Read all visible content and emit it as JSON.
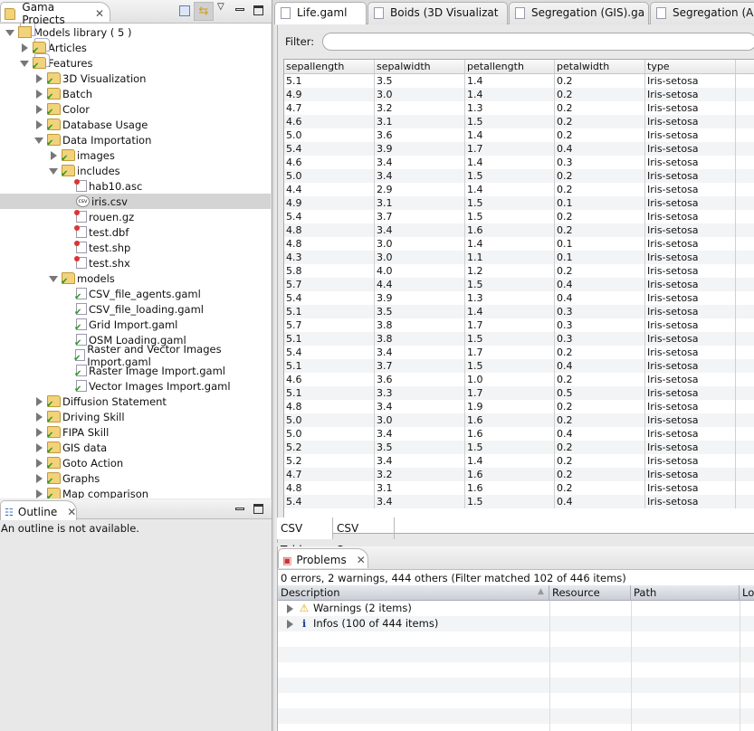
{
  "projects": {
    "title": "Gama Projects",
    "tree": [
      {
        "label": "Models library ( 5 )",
        "level": 0,
        "twisty": "open",
        "icon": "library"
      },
      {
        "label": "Articles",
        "level": 1,
        "twisty": "closed",
        "icon": "library-check"
      },
      {
        "label": "Features",
        "level": 1,
        "twisty": "open",
        "icon": "library-check"
      },
      {
        "label": "3D Visualization",
        "level": 2,
        "twisty": "closed",
        "icon": "folder-check"
      },
      {
        "label": "Batch",
        "level": 2,
        "twisty": "closed",
        "icon": "folder-check"
      },
      {
        "label": "Color",
        "level": 2,
        "twisty": "closed",
        "icon": "folder-check"
      },
      {
        "label": "Database Usage",
        "level": 2,
        "twisty": "closed",
        "icon": "folder-check"
      },
      {
        "label": "Data Importation",
        "level": 2,
        "twisty": "open",
        "icon": "folder-check"
      },
      {
        "label": "images",
        "level": 3,
        "twisty": "closed",
        "icon": "folder-check"
      },
      {
        "label": "includes",
        "level": 3,
        "twisty": "open",
        "icon": "folder-check"
      },
      {
        "label": "hab10.asc",
        "level": 4,
        "twisty": "none",
        "icon": "file"
      },
      {
        "label": "iris.csv",
        "level": 4,
        "twisty": "none",
        "icon": "csv",
        "selected": true
      },
      {
        "label": "rouen.gz",
        "level": 4,
        "twisty": "none",
        "icon": "file"
      },
      {
        "label": "test.dbf",
        "level": 4,
        "twisty": "none",
        "icon": "file"
      },
      {
        "label": "test.shp",
        "level": 4,
        "twisty": "none",
        "icon": "file"
      },
      {
        "label": "test.shx",
        "level": 4,
        "twisty": "none",
        "icon": "file"
      },
      {
        "label": "models",
        "level": 3,
        "twisty": "open",
        "icon": "folder-check"
      },
      {
        "label": "CSV_file_agents.gaml",
        "level": 4,
        "twisty": "none",
        "icon": "gaml"
      },
      {
        "label": "CSV_file_loading.gaml",
        "level": 4,
        "twisty": "none",
        "icon": "gaml"
      },
      {
        "label": "Grid Import.gaml",
        "level": 4,
        "twisty": "none",
        "icon": "gaml"
      },
      {
        "label": "OSM Loading.gaml",
        "level": 4,
        "twisty": "none",
        "icon": "gaml"
      },
      {
        "label": "Raster and Vector Images Import.gaml",
        "level": 4,
        "twisty": "none",
        "icon": "gaml"
      },
      {
        "label": "Raster Image Import.gaml",
        "level": 4,
        "twisty": "none",
        "icon": "gaml"
      },
      {
        "label": "Vector Images Import.gaml",
        "level": 4,
        "twisty": "none",
        "icon": "gaml"
      },
      {
        "label": "Diffusion Statement",
        "level": 2,
        "twisty": "closed",
        "icon": "folder-check"
      },
      {
        "label": "Driving Skill",
        "level": 2,
        "twisty": "closed",
        "icon": "folder-check"
      },
      {
        "label": "FIPA Skill",
        "level": 2,
        "twisty": "closed",
        "icon": "folder-check"
      },
      {
        "label": "GIS data",
        "level": 2,
        "twisty": "closed",
        "icon": "folder-check"
      },
      {
        "label": "Goto Action",
        "level": 2,
        "twisty": "closed",
        "icon": "folder-check"
      },
      {
        "label": "Graphs",
        "level": 2,
        "twisty": "closed",
        "icon": "folder-check"
      },
      {
        "label": "Map comparison",
        "level": 2,
        "twisty": "closed",
        "icon": "folder-check"
      }
    ]
  },
  "outline": {
    "title": "Outline",
    "message": "An outline is not available."
  },
  "editor_tabs": [
    "Life.gaml",
    "Boids (3D Visualizat",
    "Segregation (GIS).ga",
    "Segregation (Age"
  ],
  "csv": {
    "filter_label": "Filter:",
    "filter_value": "",
    "columns": [
      "sepallength",
      "sepalwidth",
      "petallength",
      "petalwidth",
      "type"
    ],
    "rows": [
      [
        "5.1",
        "3.5",
        "1.4",
        "0.2",
        "Iris-setosa"
      ],
      [
        "4.9",
        "3.0",
        "1.4",
        "0.2",
        "Iris-setosa"
      ],
      [
        "4.7",
        "3.2",
        "1.3",
        "0.2",
        "Iris-setosa"
      ],
      [
        "4.6",
        "3.1",
        "1.5",
        "0.2",
        "Iris-setosa"
      ],
      [
        "5.0",
        "3.6",
        "1.4",
        "0.2",
        "Iris-setosa"
      ],
      [
        "5.4",
        "3.9",
        "1.7",
        "0.4",
        "Iris-setosa"
      ],
      [
        "4.6",
        "3.4",
        "1.4",
        "0.3",
        "Iris-setosa"
      ],
      [
        "5.0",
        "3.4",
        "1.5",
        "0.2",
        "Iris-setosa"
      ],
      [
        "4.4",
        "2.9",
        "1.4",
        "0.2",
        "Iris-setosa"
      ],
      [
        "4.9",
        "3.1",
        "1.5",
        "0.1",
        "Iris-setosa"
      ],
      [
        "5.4",
        "3.7",
        "1.5",
        "0.2",
        "Iris-setosa"
      ],
      [
        "4.8",
        "3.4",
        "1.6",
        "0.2",
        "Iris-setosa"
      ],
      [
        "4.8",
        "3.0",
        "1.4",
        "0.1",
        "Iris-setosa"
      ],
      [
        "4.3",
        "3.0",
        "1.1",
        "0.1",
        "Iris-setosa"
      ],
      [
        "5.8",
        "4.0",
        "1.2",
        "0.2",
        "Iris-setosa"
      ],
      [
        "5.7",
        "4.4",
        "1.5",
        "0.4",
        "Iris-setosa"
      ],
      [
        "5.4",
        "3.9",
        "1.3",
        "0.4",
        "Iris-setosa"
      ],
      [
        "5.1",
        "3.5",
        "1.4",
        "0.3",
        "Iris-setosa"
      ],
      [
        "5.7",
        "3.8",
        "1.7",
        "0.3",
        "Iris-setosa"
      ],
      [
        "5.1",
        "3.8",
        "1.5",
        "0.3",
        "Iris-setosa"
      ],
      [
        "5.4",
        "3.4",
        "1.7",
        "0.2",
        "Iris-setosa"
      ],
      [
        "5.1",
        "3.7",
        "1.5",
        "0.4",
        "Iris-setosa"
      ],
      [
        "4.6",
        "3.6",
        "1.0",
        "0.2",
        "Iris-setosa"
      ],
      [
        "5.1",
        "3.3",
        "1.7",
        "0.5",
        "Iris-setosa"
      ],
      [
        "4.8",
        "3.4",
        "1.9",
        "0.2",
        "Iris-setosa"
      ],
      [
        "5.0",
        "3.0",
        "1.6",
        "0.2",
        "Iris-setosa"
      ],
      [
        "5.0",
        "3.4",
        "1.6",
        "0.4",
        "Iris-setosa"
      ],
      [
        "5.2",
        "3.5",
        "1.5",
        "0.2",
        "Iris-setosa"
      ],
      [
        "5.2",
        "3.4",
        "1.4",
        "0.2",
        "Iris-setosa"
      ],
      [
        "4.7",
        "3.2",
        "1.6",
        "0.2",
        "Iris-setosa"
      ],
      [
        "4.8",
        "3.1",
        "1.6",
        "0.2",
        "Iris-setosa"
      ],
      [
        "5.4",
        "3.4",
        "1.5",
        "0.4",
        "Iris-setosa"
      ]
    ],
    "tabs": [
      "CSV Table",
      "CSV Source"
    ]
  },
  "problems": {
    "title": "Problems",
    "summary": "0 errors, 2 warnings, 444 others (Filter matched 102 of 446 items)",
    "columns": [
      "Description",
      "Resource",
      "Path",
      "Lo"
    ],
    "groups": [
      {
        "label": "Warnings (2 items)",
        "icon": "warning-icon"
      },
      {
        "label": "Infos (100 of 444 items)",
        "icon": "info-icon"
      }
    ]
  }
}
